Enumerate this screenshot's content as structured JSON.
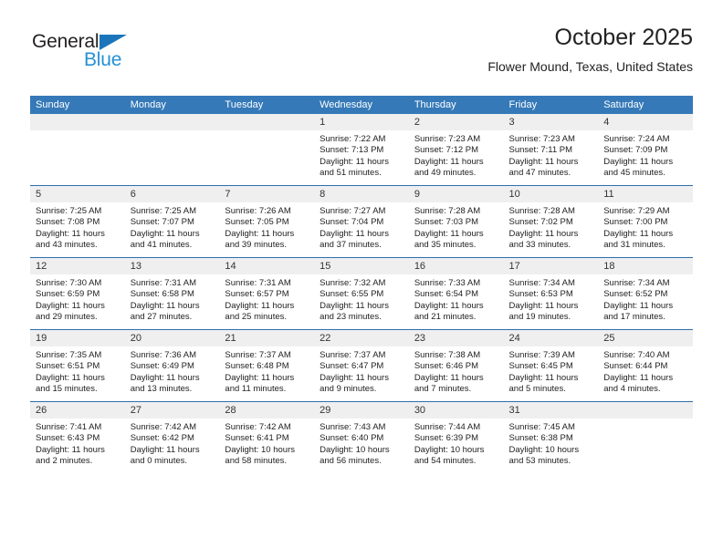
{
  "brand": {
    "name_part1": "General",
    "name_part2": "Blue",
    "color_dark": "#231f20",
    "color_blue": "#2591d4",
    "triangle_color": "#1b75bb"
  },
  "header": {
    "title": "October 2025",
    "subtitle": "Flower Mound, Texas, United States"
  },
  "theme": {
    "header_row_bg": "#3579b8",
    "daynum_bg": "#efefef",
    "row_divider": "#2f6fae"
  },
  "weekday_headers": [
    "Sunday",
    "Monday",
    "Tuesday",
    "Wednesday",
    "Thursday",
    "Friday",
    "Saturday"
  ],
  "weeks": [
    [
      {
        "empty": true
      },
      {
        "empty": true
      },
      {
        "empty": true
      },
      {
        "day": "1",
        "sunrise": "Sunrise: 7:22 AM",
        "sunset": "Sunset: 7:13 PM",
        "daylight_line1": "Daylight: 11 hours",
        "daylight_line2": "and 51 minutes."
      },
      {
        "day": "2",
        "sunrise": "Sunrise: 7:23 AM",
        "sunset": "Sunset: 7:12 PM",
        "daylight_line1": "Daylight: 11 hours",
        "daylight_line2": "and 49 minutes."
      },
      {
        "day": "3",
        "sunrise": "Sunrise: 7:23 AM",
        "sunset": "Sunset: 7:11 PM",
        "daylight_line1": "Daylight: 11 hours",
        "daylight_line2": "and 47 minutes."
      },
      {
        "day": "4",
        "sunrise": "Sunrise: 7:24 AM",
        "sunset": "Sunset: 7:09 PM",
        "daylight_line1": "Daylight: 11 hours",
        "daylight_line2": "and 45 minutes."
      }
    ],
    [
      {
        "day": "5",
        "sunrise": "Sunrise: 7:25 AM",
        "sunset": "Sunset: 7:08 PM",
        "daylight_line1": "Daylight: 11 hours",
        "daylight_line2": "and 43 minutes."
      },
      {
        "day": "6",
        "sunrise": "Sunrise: 7:25 AM",
        "sunset": "Sunset: 7:07 PM",
        "daylight_line1": "Daylight: 11 hours",
        "daylight_line2": "and 41 minutes."
      },
      {
        "day": "7",
        "sunrise": "Sunrise: 7:26 AM",
        "sunset": "Sunset: 7:05 PM",
        "daylight_line1": "Daylight: 11 hours",
        "daylight_line2": "and 39 minutes."
      },
      {
        "day": "8",
        "sunrise": "Sunrise: 7:27 AM",
        "sunset": "Sunset: 7:04 PM",
        "daylight_line1": "Daylight: 11 hours",
        "daylight_line2": "and 37 minutes."
      },
      {
        "day": "9",
        "sunrise": "Sunrise: 7:28 AM",
        "sunset": "Sunset: 7:03 PM",
        "daylight_line1": "Daylight: 11 hours",
        "daylight_line2": "and 35 minutes."
      },
      {
        "day": "10",
        "sunrise": "Sunrise: 7:28 AM",
        "sunset": "Sunset: 7:02 PM",
        "daylight_line1": "Daylight: 11 hours",
        "daylight_line2": "and 33 minutes."
      },
      {
        "day": "11",
        "sunrise": "Sunrise: 7:29 AM",
        "sunset": "Sunset: 7:00 PM",
        "daylight_line1": "Daylight: 11 hours",
        "daylight_line2": "and 31 minutes."
      }
    ],
    [
      {
        "day": "12",
        "sunrise": "Sunrise: 7:30 AM",
        "sunset": "Sunset: 6:59 PM",
        "daylight_line1": "Daylight: 11 hours",
        "daylight_line2": "and 29 minutes."
      },
      {
        "day": "13",
        "sunrise": "Sunrise: 7:31 AM",
        "sunset": "Sunset: 6:58 PM",
        "daylight_line1": "Daylight: 11 hours",
        "daylight_line2": "and 27 minutes."
      },
      {
        "day": "14",
        "sunrise": "Sunrise: 7:31 AM",
        "sunset": "Sunset: 6:57 PM",
        "daylight_line1": "Daylight: 11 hours",
        "daylight_line2": "and 25 minutes."
      },
      {
        "day": "15",
        "sunrise": "Sunrise: 7:32 AM",
        "sunset": "Sunset: 6:55 PM",
        "daylight_line1": "Daylight: 11 hours",
        "daylight_line2": "and 23 minutes."
      },
      {
        "day": "16",
        "sunrise": "Sunrise: 7:33 AM",
        "sunset": "Sunset: 6:54 PM",
        "daylight_line1": "Daylight: 11 hours",
        "daylight_line2": "and 21 minutes."
      },
      {
        "day": "17",
        "sunrise": "Sunrise: 7:34 AM",
        "sunset": "Sunset: 6:53 PM",
        "daylight_line1": "Daylight: 11 hours",
        "daylight_line2": "and 19 minutes."
      },
      {
        "day": "18",
        "sunrise": "Sunrise: 7:34 AM",
        "sunset": "Sunset: 6:52 PM",
        "daylight_line1": "Daylight: 11 hours",
        "daylight_line2": "and 17 minutes."
      }
    ],
    [
      {
        "day": "19",
        "sunrise": "Sunrise: 7:35 AM",
        "sunset": "Sunset: 6:51 PM",
        "daylight_line1": "Daylight: 11 hours",
        "daylight_line2": "and 15 minutes."
      },
      {
        "day": "20",
        "sunrise": "Sunrise: 7:36 AM",
        "sunset": "Sunset: 6:49 PM",
        "daylight_line1": "Daylight: 11 hours",
        "daylight_line2": "and 13 minutes."
      },
      {
        "day": "21",
        "sunrise": "Sunrise: 7:37 AM",
        "sunset": "Sunset: 6:48 PM",
        "daylight_line1": "Daylight: 11 hours",
        "daylight_line2": "and 11 minutes."
      },
      {
        "day": "22",
        "sunrise": "Sunrise: 7:37 AM",
        "sunset": "Sunset: 6:47 PM",
        "daylight_line1": "Daylight: 11 hours",
        "daylight_line2": "and 9 minutes."
      },
      {
        "day": "23",
        "sunrise": "Sunrise: 7:38 AM",
        "sunset": "Sunset: 6:46 PM",
        "daylight_line1": "Daylight: 11 hours",
        "daylight_line2": "and 7 minutes."
      },
      {
        "day": "24",
        "sunrise": "Sunrise: 7:39 AM",
        "sunset": "Sunset: 6:45 PM",
        "daylight_line1": "Daylight: 11 hours",
        "daylight_line2": "and 5 minutes."
      },
      {
        "day": "25",
        "sunrise": "Sunrise: 7:40 AM",
        "sunset": "Sunset: 6:44 PM",
        "daylight_line1": "Daylight: 11 hours",
        "daylight_line2": "and 4 minutes."
      }
    ],
    [
      {
        "day": "26",
        "sunrise": "Sunrise: 7:41 AM",
        "sunset": "Sunset: 6:43 PM",
        "daylight_line1": "Daylight: 11 hours",
        "daylight_line2": "and 2 minutes."
      },
      {
        "day": "27",
        "sunrise": "Sunrise: 7:42 AM",
        "sunset": "Sunset: 6:42 PM",
        "daylight_line1": "Daylight: 11 hours",
        "daylight_line2": "and 0 minutes."
      },
      {
        "day": "28",
        "sunrise": "Sunrise: 7:42 AM",
        "sunset": "Sunset: 6:41 PM",
        "daylight_line1": "Daylight: 10 hours",
        "daylight_line2": "and 58 minutes."
      },
      {
        "day": "29",
        "sunrise": "Sunrise: 7:43 AM",
        "sunset": "Sunset: 6:40 PM",
        "daylight_line1": "Daylight: 10 hours",
        "daylight_line2": "and 56 minutes."
      },
      {
        "day": "30",
        "sunrise": "Sunrise: 7:44 AM",
        "sunset": "Sunset: 6:39 PM",
        "daylight_line1": "Daylight: 10 hours",
        "daylight_line2": "and 54 minutes."
      },
      {
        "day": "31",
        "sunrise": "Sunrise: 7:45 AM",
        "sunset": "Sunset: 6:38 PM",
        "daylight_line1": "Daylight: 10 hours",
        "daylight_line2": "and 53 minutes."
      },
      {
        "empty": true
      }
    ]
  ]
}
